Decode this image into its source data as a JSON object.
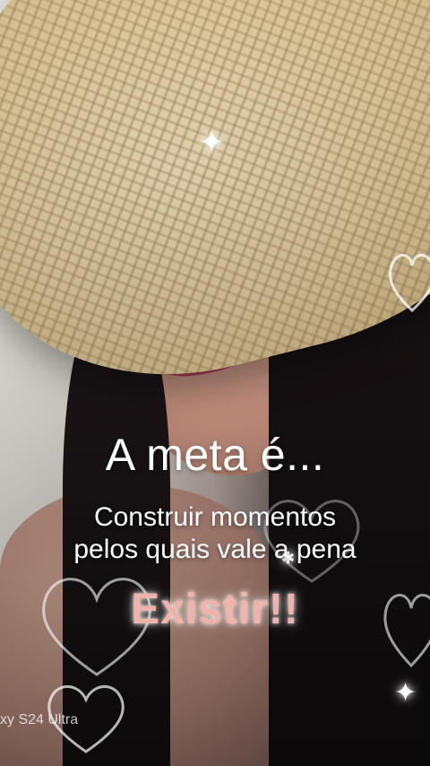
{
  "overlay": {
    "headline": "A meta é...",
    "line1": "Construir momentos",
    "line2": "pelos quais vale a pena",
    "emphasis": "Existir!!",
    "watermark": "xy S24 Ultra"
  },
  "colors": {
    "text": "#ffffff",
    "emphasis": "#f0b3ab"
  },
  "decorations": {
    "hearts": [
      "heart-outline-icon",
      "heart-outline-icon",
      "heart-outline-icon",
      "heart-outline-icon",
      "heart-outline-icon"
    ],
    "sparkles": [
      "sparkle-icon",
      "sparkle-icon",
      "sparkle-icon"
    ]
  }
}
